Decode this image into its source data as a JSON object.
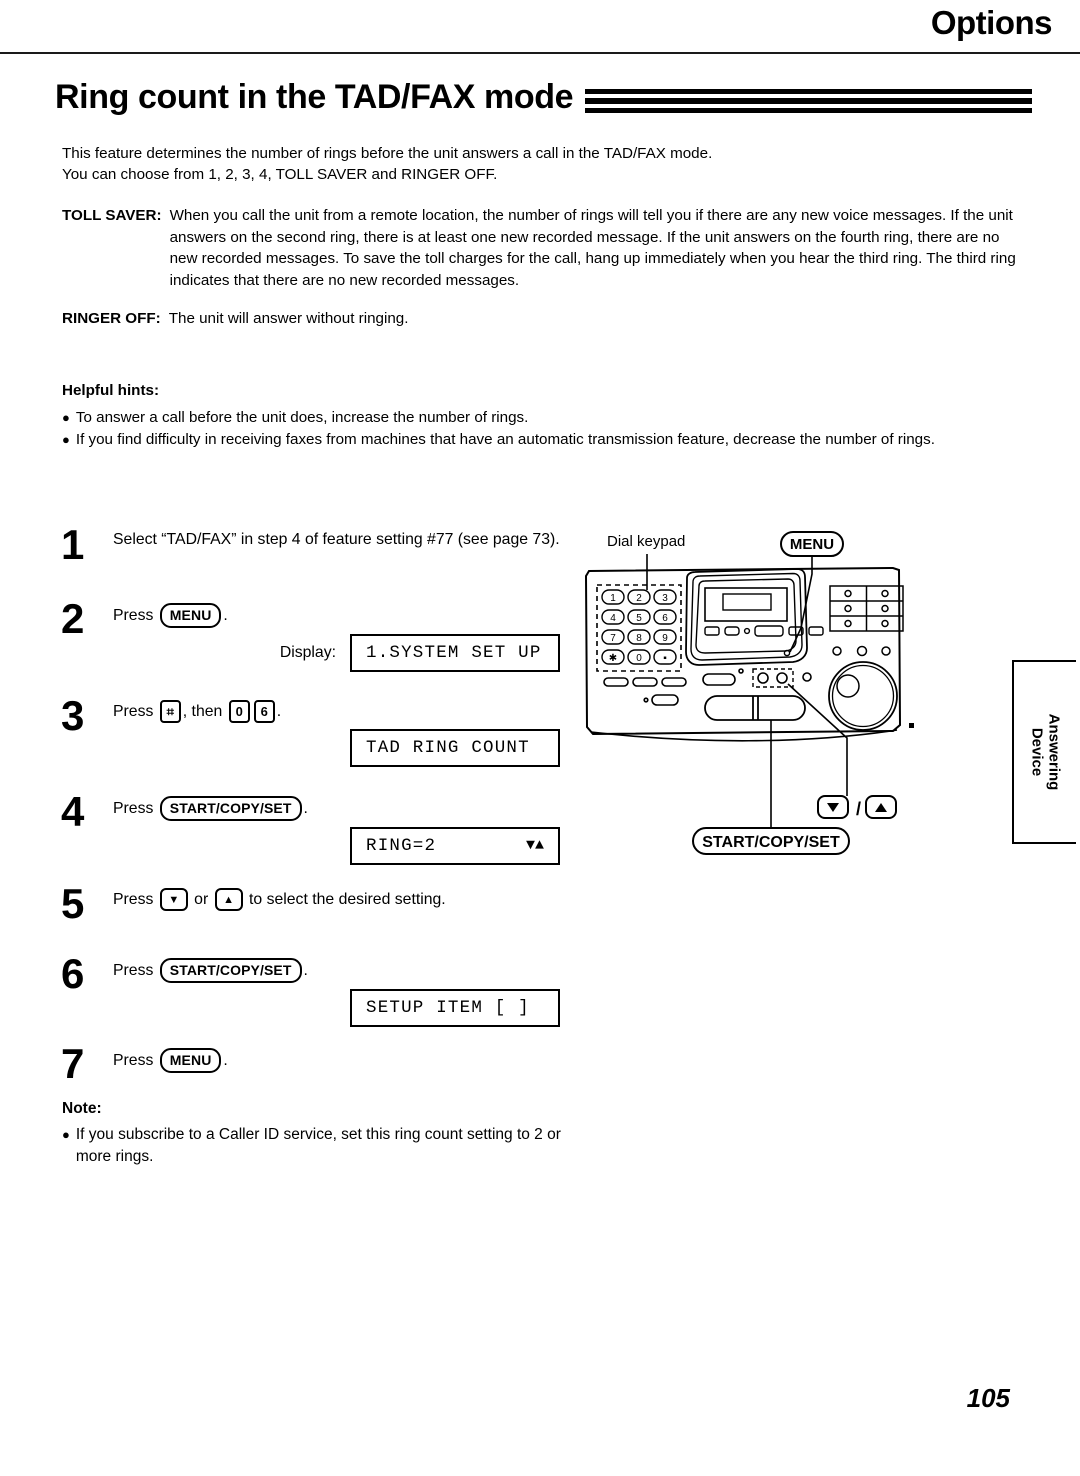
{
  "header": {
    "section_tab": "Options"
  },
  "title": {
    "text": "Ring count in the TAD/FAX mode"
  },
  "intro": {
    "line1": "This feature determines the number of rings before the unit answers a call in the TAD/FAX mode.",
    "line2": "You can choose from 1, 2, 3, 4, TOLL SAVER and RINGER OFF."
  },
  "definitions": [
    {
      "term": "TOLL SAVER:",
      "body": "When you call the unit from a remote location, the number of rings will tell you if there are any new voice messages. If the unit answers on the second ring, there is at least one new recorded message. If the unit answers on the fourth ring, there are no new recorded messages. To save the toll charges for the call, hang up immediately when you hear the third ring. The third ring indicates that there are no new recorded messages."
    },
    {
      "term": "RINGER OFF:",
      "body": "The unit will answer without ringing."
    }
  ],
  "hints": {
    "title": "Helpful hints:",
    "bullet_glyph": "●",
    "items": [
      "To answer a call before the unit does, increase the number of rings.",
      "If you find difficulty in receiving faxes from machines that have an automatic transmission feature, decrease the number of rings."
    ]
  },
  "steps": [
    {
      "num": "1",
      "text_before": "Select “TAD/FAX” in step 4 of feature setting #77 (see page 73)."
    },
    {
      "num": "2",
      "press_label": "Press",
      "button": "MENU",
      "period": ".",
      "display_label": "Display:",
      "lcd": "1.SYSTEM SET UP"
    },
    {
      "num": "3",
      "press_label": "Press",
      "key1": "⌗",
      "mid_label": ", then",
      "key2": "0",
      "key3": "6",
      "period": ".",
      "lcd": "TAD RING COUNT"
    },
    {
      "num": "4",
      "press_label": "Press",
      "button": "START/COPY/SET",
      "period": ".",
      "lcd": "RING=2",
      "lcd_arrows": "▼▲"
    },
    {
      "num": "5",
      "press_label": "Press",
      "key_down": "▼",
      "or_label": "or",
      "key_up": "▲",
      "tail_label": "to select the desired setting."
    },
    {
      "num": "6",
      "press_label": "Press",
      "button": "START/COPY/SET",
      "period": ".",
      "lcd": "SETUP ITEM [    ]"
    },
    {
      "num": "7",
      "press_label": "Press",
      "button": "MENU",
      "period": "."
    }
  ],
  "note": {
    "title": "Note:",
    "bullet_glyph": "●",
    "text": "If you subscribe to a Caller ID service, set this ring count setting to 2 or more rings."
  },
  "diagram": {
    "callout_keypad": "Dial keypad",
    "callout_menu": "MENU",
    "callout_arrows_down": "▼",
    "callout_arrows_sep": "/",
    "callout_arrows_up": "▲",
    "callout_start": "START/COPY/SET",
    "keypad_keys": [
      "1",
      "2",
      "3",
      "4",
      "5",
      "6",
      "7",
      "8",
      "9",
      "✱",
      "0",
      "■"
    ]
  },
  "side_tab": {
    "line1": "Answering",
    "line2": "Device"
  },
  "footer": {
    "page_number": "105"
  }
}
